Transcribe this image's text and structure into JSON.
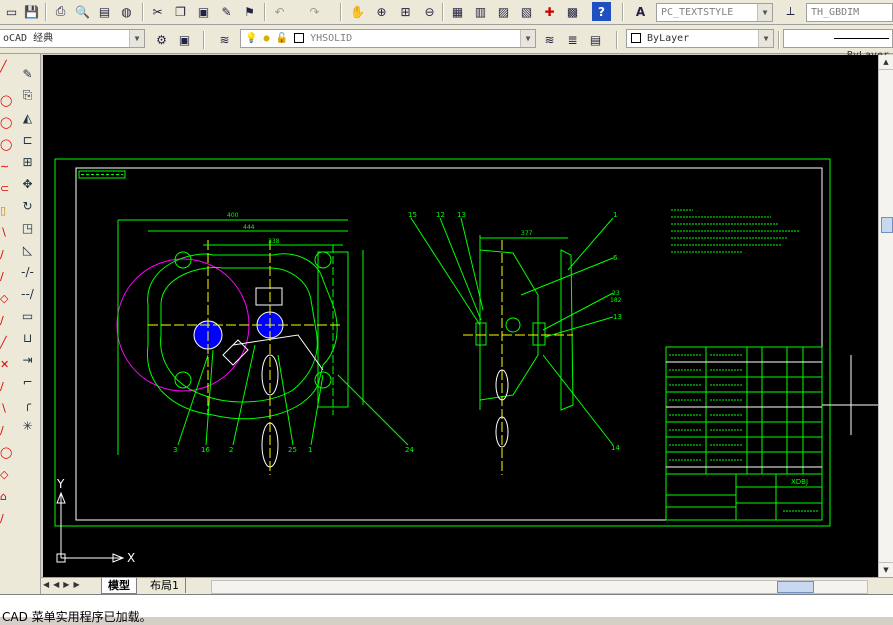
{
  "toolbar_top": {
    "textstyle_value": "PC_TEXTSTYLE",
    "dimstyle_value": "TH_GBDIM"
  },
  "toolbar_second": {
    "workspace_value": "oCAD 经典",
    "layer_value": "YHSOLID",
    "color_value": "ByLayer",
    "linetype_value": "ByLayer"
  },
  "layout_tabs": [
    "模型",
    "布局1"
  ],
  "command_line": "CAD 菜单实用程序已加载。",
  "drawing": {
    "title_block_center": "XDBJ",
    "dim_top_1": "400",
    "dim_top_2": "444",
    "dim_top_3": "338",
    "dim_side": "377",
    "ucs_x": "X",
    "ucs_y": "Y",
    "balloons": [
      "3",
      "16",
      "2",
      "25",
      "1",
      "24",
      "15",
      "12",
      "13",
      "1",
      "6",
      "23",
      "182",
      "13",
      "14"
    ]
  },
  "colors": {
    "canvas": "#000000",
    "geometry": "#00ff00",
    "accent": "#ffffff",
    "magenta": "#ff00ff",
    "blue": "#0000ff"
  }
}
